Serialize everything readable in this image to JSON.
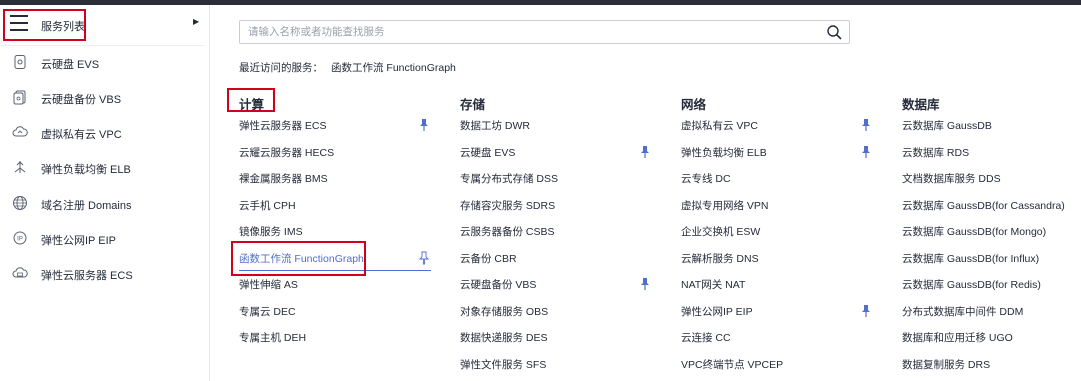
{
  "sidebar": {
    "title": "服务列表",
    "items": [
      {
        "label": "云硬盘 EVS",
        "icon": "disk-icon"
      },
      {
        "label": "云硬盘备份 VBS",
        "icon": "backup-icon"
      },
      {
        "label": "虚拟私有云 VPC",
        "icon": "cloud-icon"
      },
      {
        "label": "弹性负载均衡 ELB",
        "icon": "load-balancer-icon"
      },
      {
        "label": "域名注册 Domains",
        "icon": "globe-icon"
      },
      {
        "label": "弹性公网IP EIP",
        "icon": "ip-icon"
      },
      {
        "label": "弹性云服务器 ECS",
        "icon": "server-icon"
      }
    ]
  },
  "search": {
    "placeholder": "请输入名称或者功能查找服务"
  },
  "recent": {
    "label": "最近访问的服务：",
    "items": [
      "函数工作流 FunctionGraph"
    ]
  },
  "categories": [
    {
      "title": "计算",
      "items": [
        "弹性云服务器 ECS",
        "云耀云服务器 HECS",
        "裸金属服务器 BMS",
        "云手机 CPH",
        "镜像服务 IMS",
        "函数工作流 FunctionGraph",
        "弹性伸缩 AS",
        "专属云 DEC",
        "专属主机 DEH"
      ]
    },
    {
      "title": "存储",
      "items": [
        "数据工坊 DWR",
        "云硬盘 EVS",
        "专属分布式存储 DSS",
        "存储容灾服务 SDRS",
        "云服务器备份 CSBS",
        "云备份 CBR",
        "云硬盘备份 VBS",
        "对象存储服务 OBS",
        "数据快递服务 DES",
        "弹性文件服务 SFS"
      ]
    },
    {
      "title": "网络",
      "items": [
        "虚拟私有云 VPC",
        "弹性负载均衡 ELB",
        "云专线 DC",
        "虚拟专用网络 VPN",
        "企业交换机 ESW",
        "云解析服务 DNS",
        "NAT网关 NAT",
        "弹性公网IP EIP",
        "云连接 CC",
        "VPC终端节点 VPCEP"
      ]
    },
    {
      "title": "数据库",
      "items": [
        "云数据库 GaussDB",
        "云数据库 RDS",
        "文档数据库服务 DDS",
        "云数据库 GaussDB(for Cassandra)",
        "云数据库 GaussDB(for Mongo)",
        "云数据库 GaussDB(for Influx)",
        "云数据库 GaussDB(for Redis)",
        "分布式数据库中间件 DDM",
        "数据库和应用迁移 UGO",
        "数据复制服务 DRS"
      ]
    }
  ],
  "colors": {
    "accent": "#526ecc",
    "highlight": "#d0021b",
    "pinned": "#526ecc"
  }
}
